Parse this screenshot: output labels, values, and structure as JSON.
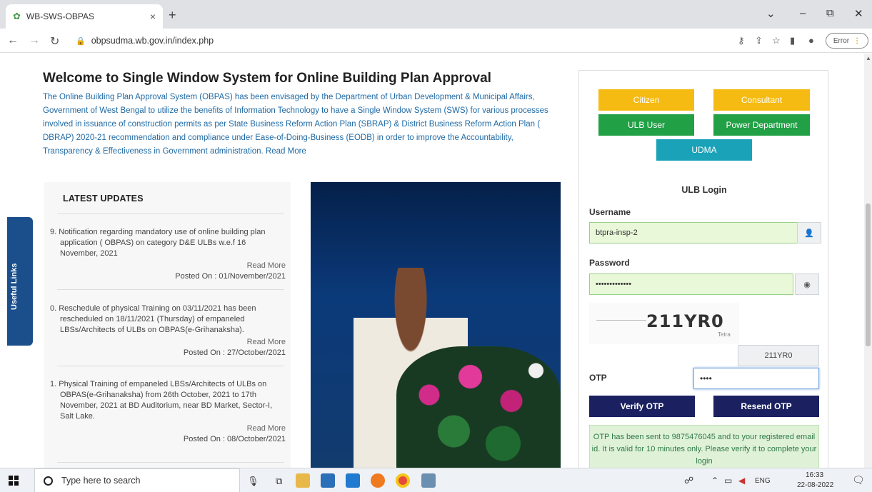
{
  "browser": {
    "tab_title": "WB-SWS-OBPAS",
    "tab_close": "×",
    "new_tab": "+",
    "url": "obpsudma.wb.gov.in/index.php",
    "error_label": "Error",
    "win_min": "–",
    "win_restore": "⧉",
    "win_close": "✕",
    "dropdown": "⌄"
  },
  "welcome": {
    "title": "Welcome to Single Window System for Online Building Plan Approval",
    "text": "The Online Building Plan Approval System (OBPAS) has been envisaged by the Department of Urban Development & Municipal Affairs, Government of West Bengal to utilize the benefits of Information Technology to have a Single Window System (SWS) for various processes involved in issuance of construction permits as per State Business Reform Action Plan (SBRAP) & District Business Reform Action Plan ( DBRAP) 2020-21 recommendation and compliance under Ease-of-Doing-Business (EODB) in order to improve the Accountability, Transparency & Effectiveness in Government administration. Read More"
  },
  "useful_links": "Useful Links",
  "updates": {
    "heading": "LATEST UPDATES",
    "items": [
      {
        "text": "9. Notification regarding mandatory use of online building plan application ( OBPAS) on category D&E ULBs w.e.f 16 November, 2021",
        "more": "Read More",
        "posted": "Posted On : 01/November/2021"
      },
      {
        "text": "0. Reschedule of physical Training on 03/11/2021 has been rescheduled on 18/11/2021 (Thursday) of empaneled LBSs/Architects of ULBs on OBPAS(e-Grihanaksha).",
        "more": "Read More",
        "posted": "Posted On : 27/October/2021"
      },
      {
        "text": "1. Physical Training of empaneled LBSs/Architects of ULBs on OBPAS(e-Grihanaksha) from 26th October, 2021 to 17th November, 2021 at BD Auditorium, near BD Market, Sector-I, Salt Lake.",
        "more": "Read More",
        "posted": "Posted On : 08/October/2021"
      }
    ]
  },
  "login": {
    "roles": {
      "citizen": "Citizen",
      "consultant": "Consultant",
      "ulb_user": "ULB User",
      "power_department": "Power Department",
      "udma": "UDMA"
    },
    "heading": "ULB Login",
    "username_label": "Username",
    "username_value": "btpra-insp-2",
    "password_label": "Password",
    "password_value": "•••••••••••••",
    "captcha_text": "211YR0",
    "captcha_mark": "Tetra",
    "captcha_value": "211YR0",
    "otp_label": "OTP",
    "otp_value": "••••",
    "verify_otp": "Verify OTP",
    "resend_otp": "Resend OTP",
    "otp_message": "OTP has been sent to 9875476045 and to your registered email id. It is valid for 10 minutes only. Please verify it to complete your login"
  },
  "taskbar": {
    "search_placeholder": "Type here to search",
    "lang": "ENG",
    "time": "16:33",
    "date": "22-08-2022"
  }
}
